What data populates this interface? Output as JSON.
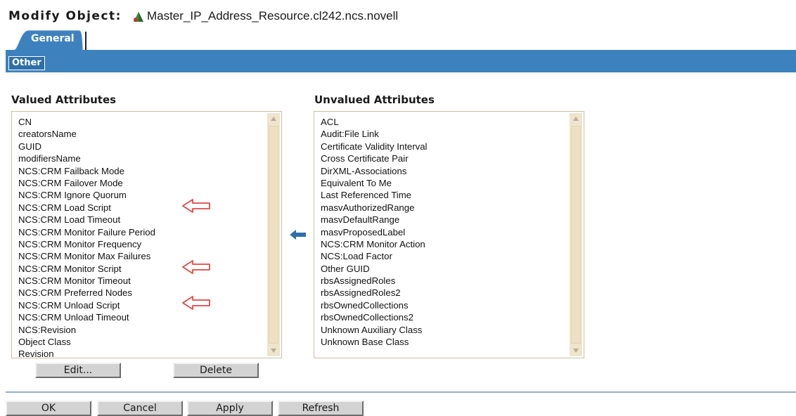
{
  "header": {
    "label": "Modify Object:",
    "object_name": "Master_IP_Address_Resource.cl242.ncs.novell"
  },
  "tabs": {
    "general": "General",
    "other": "Other"
  },
  "valued": {
    "title": "Valued Attributes",
    "items": [
      "CN",
      "creatorsName",
      "GUID",
      "modifiersName",
      "NCS:CRM Failback Mode",
      "NCS:CRM Failover Mode",
      "NCS:CRM Ignore Quorum",
      "NCS:CRM Load Script",
      "NCS:CRM Load Timeout",
      "NCS:CRM Monitor Failure Period",
      "NCS:CRM Monitor Frequency",
      "NCS:CRM Monitor Max Failures",
      "NCS:CRM Monitor Script",
      "NCS:CRM Monitor Timeout",
      "NCS:CRM Preferred Nodes",
      "NCS:CRM Unload Script",
      "NCS:CRM Unload Timeout",
      "NCS:Revision",
      "Object Class",
      "Revision"
    ],
    "edit_label": "Edit...",
    "delete_label": "Delete"
  },
  "unvalued": {
    "title": "Unvalued Attributes",
    "items": [
      "ACL",
      "Audit:File Link",
      "Certificate Validity Interval",
      "Cross Certificate Pair",
      "DirXML-Associations",
      "Equivalent To Me",
      "Last Referenced Time",
      "masvAuthorizedRange",
      "masvDefaultRange",
      "masvProposedLabel",
      "NCS:CRM Monitor Action",
      "NCS:Load Factor",
      "Other GUID",
      "rbsAssignedRoles",
      "rbsAssignedRoles2",
      "rbsOwnedCollections",
      "rbsOwnedCollections2",
      "Unknown Auxiliary Class",
      "Unknown Base Class"
    ]
  },
  "footer": {
    "ok_label": "OK",
    "cancel_label": "Cancel",
    "apply_label": "Apply",
    "refresh_label": "Refresh"
  },
  "colors": {
    "band": "#3d82be",
    "tab": "#2f6fa8",
    "scroll_track": "#efe4cd",
    "button_face": "#d3d3d3",
    "callout_arrow": "#e04848",
    "move_arrow": "#2f6fa8"
  },
  "icons": {
    "object": "resource-object-icon",
    "callout": "hollow-left-arrow-icon",
    "move": "move-left-arrow-icon",
    "scroll_up": "scroll-up-arrow-icon",
    "scroll_down": "scroll-down-arrow-icon"
  }
}
